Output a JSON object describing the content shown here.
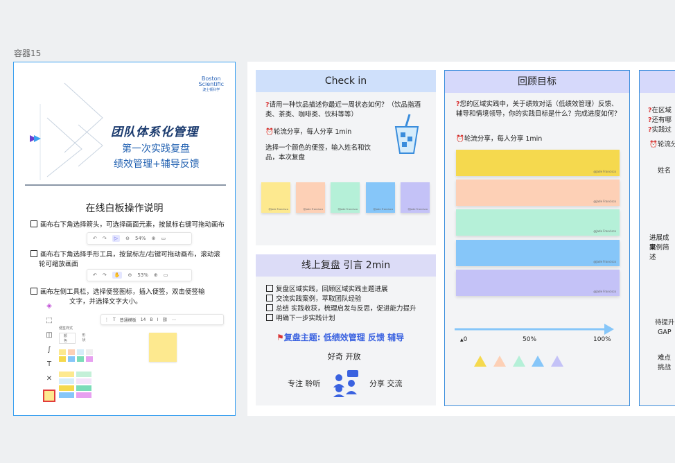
{
  "container_label": "容器15",
  "left_frame": {
    "logo_line1": "Boston",
    "logo_line2": "Scientific",
    "logo_line3": "波士顿科学",
    "title_main": "团队体系化管理",
    "title_sub1": "第一次实践复盘",
    "title_sub2": "绩效管理+辅导反馈",
    "section_title": "在线白板操作说明",
    "instr1": "画布右下角选择箭头，可选择画面元素，按鼠标右键可拖动画布",
    "instr2a": "画布右下角选择手形工具，按鼠标左/右键可拖动画布，滚动滚",
    "instr2b": "轮可缩放画面",
    "instr3a": "画布左侧工具栏，选择便签图标，插入便签，双击便签输",
    "instr3b": "文字，并选择文字大小。",
    "zoom1": "54%",
    "zoom2": "53%",
    "note_toolbar_font": "普通模板",
    "note_toolbar_size": "14",
    "palette_title": "便签样式",
    "palette_tab1": "颜色",
    "palette_tab2": "形状"
  },
  "checkin": {
    "title": "Check in",
    "q1": "请用一种饮品描述你最近一周状态如何？（饮品指酒类、茶类、咖啡类、饮料等等）",
    "rule": "轮流分享，每人分享 1min",
    "instruction": "选择一个颜色的便签，输入姓名和饮品，本次复盘",
    "note_label": "@Jade Francisco",
    "colors": [
      "#fde98f",
      "#fdd0b6",
      "#b5f0d8",
      "#86c6f9",
      "#c4c2f7"
    ]
  },
  "review": {
    "title": "线上复盘 引言  2min",
    "items": [
      "复盘区域实践，回顾区域实践主题进展",
      "交流实践案例，萃取团队经验",
      "总结 实践收获，梳理启发与反思，促进能力提升",
      "明确下一步实践计划"
    ],
    "theme_label": "复盘主题:",
    "theme_value": "低绩效管理  反馈  辅导",
    "words_top": "好奇  开放",
    "words_left": "专注  聆听",
    "words_right": "分享  交流"
  },
  "goals": {
    "title": "回顾目标",
    "q1": "您的区域实践中，关于绩效对话（低绩效管理）反馈、辅导和情境领导，你的实践目标是什么？完成进度如何？",
    "rule": "轮流分享，每人分享 1min",
    "note_colors": [
      "#f5d94e",
      "#fdd0b6",
      "#b5f0d8",
      "#86c6f9",
      "#c4c2f7"
    ],
    "note_label": "@Jade Francisco",
    "scale": [
      "0",
      "50%",
      "100%"
    ],
    "triangle_colors": [
      "#f5d94e",
      "#fdd0b6",
      "#b5f0d8",
      "#86c6f9",
      "#c4c2f7"
    ]
  },
  "practice": {
    "q1": "在区域",
    "q2": "还有哪",
    "q3": "实践过",
    "rule": "轮流分",
    "rows": [
      "姓名",
      "进展成果",
      "案例简述",
      "待提升",
      "GAP",
      "难点",
      "挑战"
    ]
  }
}
